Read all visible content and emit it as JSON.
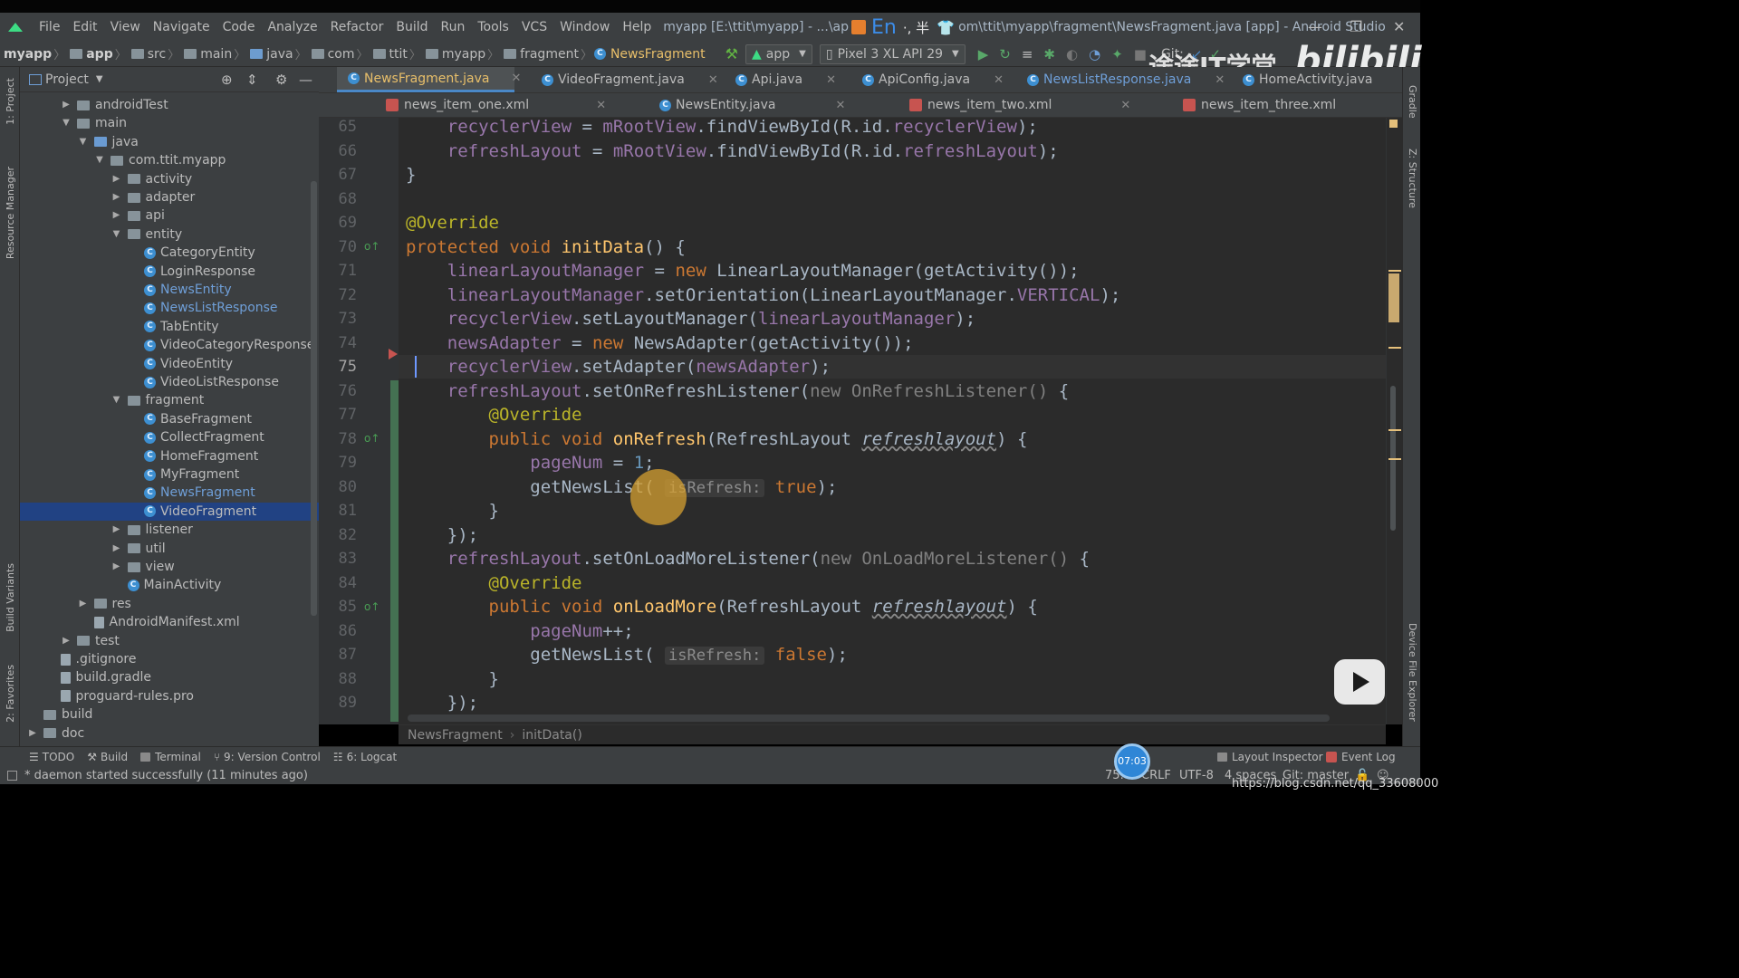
{
  "window": {
    "menu": [
      "File",
      "Edit",
      "View",
      "Navigate",
      "Code",
      "Analyze",
      "Refactor",
      "Build",
      "Run",
      "Tools",
      "VCS",
      "Window",
      "Help"
    ],
    "title_left": "myapp [E:\\ttit\\myapp] - ...\\ap",
    "ime_text": "En",
    "ime_extra": "·, 半",
    "title_right": "om\\ttit\\myapp\\fragment\\NewsFragment.java [app] - Android Studio"
  },
  "navbar": {
    "crumbs": [
      "myapp",
      "app",
      "src",
      "main",
      "java",
      "com",
      "ttit",
      "myapp",
      "fragment",
      "NewsFragment"
    ],
    "run_config": "app",
    "device": "Pixel 3 XL API 29",
    "git_label": "Git:"
  },
  "watermark": {
    "text": "途途IT学堂",
    "brand": "bilibili"
  },
  "side_left": {
    "top": "1: Project",
    "resource": "Resource Manager",
    "build_variants": "Build Variants",
    "favorites": "2: Favorites"
  },
  "side_right": {
    "gradle": "Gradle",
    "structure": "Z: Structure",
    "device_explorer": "Device File Explorer"
  },
  "project": {
    "title": "Project",
    "tree": [
      {
        "label": "androidTest",
        "depth": 3,
        "kind": "folder",
        "arrow": "▶"
      },
      {
        "label": "main",
        "depth": 3,
        "kind": "folder",
        "arrow": "▼"
      },
      {
        "label": "java",
        "depth": 4,
        "kind": "folder-blue",
        "arrow": "▼"
      },
      {
        "label": "com.ttit.myapp",
        "depth": 5,
        "kind": "pkg",
        "arrow": "▼"
      },
      {
        "label": "activity",
        "depth": 6,
        "kind": "pkg",
        "arrow": "▶"
      },
      {
        "label": "adapter",
        "depth": 6,
        "kind": "pkg",
        "arrow": "▶"
      },
      {
        "label": "api",
        "depth": 6,
        "kind": "pkg",
        "arrow": "▶"
      },
      {
        "label": "entity",
        "depth": 6,
        "kind": "pkg",
        "arrow": "▼"
      },
      {
        "label": "CategoryEntity",
        "depth": 7,
        "kind": "class",
        "arrow": ""
      },
      {
        "label": "LoginResponse",
        "depth": 7,
        "kind": "class",
        "arrow": ""
      },
      {
        "label": "NewsEntity",
        "depth": 7,
        "kind": "class-blue",
        "arrow": ""
      },
      {
        "label": "NewsListResponse",
        "depth": 7,
        "kind": "class-blue",
        "arrow": ""
      },
      {
        "label": "TabEntity",
        "depth": 7,
        "kind": "class",
        "arrow": ""
      },
      {
        "label": "VideoCategoryResponse",
        "depth": 7,
        "kind": "class",
        "arrow": ""
      },
      {
        "label": "VideoEntity",
        "depth": 7,
        "kind": "class",
        "arrow": ""
      },
      {
        "label": "VideoListResponse",
        "depth": 7,
        "kind": "class",
        "arrow": ""
      },
      {
        "label": "fragment",
        "depth": 6,
        "kind": "pkg",
        "arrow": "▼"
      },
      {
        "label": "BaseFragment",
        "depth": 7,
        "kind": "class",
        "arrow": ""
      },
      {
        "label": "CollectFragment",
        "depth": 7,
        "kind": "class",
        "arrow": ""
      },
      {
        "label": "HomeFragment",
        "depth": 7,
        "kind": "class",
        "arrow": ""
      },
      {
        "label": "MyFragment",
        "depth": 7,
        "kind": "class",
        "arrow": ""
      },
      {
        "label": "NewsFragment",
        "depth": 7,
        "kind": "class-blue",
        "arrow": ""
      },
      {
        "label": "VideoFragment",
        "depth": 7,
        "kind": "class-selected",
        "arrow": ""
      },
      {
        "label": "listener",
        "depth": 6,
        "kind": "pkg",
        "arrow": "▶"
      },
      {
        "label": "util",
        "depth": 6,
        "kind": "pkg",
        "arrow": "▶"
      },
      {
        "label": "view",
        "depth": 6,
        "kind": "pkg",
        "arrow": "▶"
      },
      {
        "label": "MainActivity",
        "depth": 6,
        "kind": "class",
        "arrow": ""
      },
      {
        "label": "res",
        "depth": 4,
        "kind": "folder",
        "arrow": "▶"
      },
      {
        "label": "AndroidManifest.xml",
        "depth": 4,
        "kind": "file",
        "arrow": ""
      },
      {
        "label": "test",
        "depth": 3,
        "kind": "folder",
        "arrow": "▶"
      },
      {
        "label": ".gitignore",
        "depth": 2,
        "kind": "file",
        "arrow": ""
      },
      {
        "label": "build.gradle",
        "depth": 2,
        "kind": "file",
        "arrow": ""
      },
      {
        "label": "proguard-rules.pro",
        "depth": 2,
        "kind": "file",
        "arrow": ""
      },
      {
        "label": "build",
        "depth": 1,
        "kind": "folder",
        "arrow": ""
      },
      {
        "label": "doc",
        "depth": 1,
        "kind": "folder",
        "arrow": "▶"
      }
    ]
  },
  "tabs_row1": [
    "NewsFragment.java",
    "VideoFragment.java",
    "Api.java",
    "ApiConfig.java",
    "NewsListResponse.java",
    "HomeActivity.java"
  ],
  "tabs_row2": [
    "news_item_one.xml",
    "NewsEntity.java",
    "news_item_two.xml",
    "news_item_three.xml"
  ],
  "editor": {
    "line_numbers": [
      "65",
      "66",
      "67",
      "68",
      "69",
      "70",
      "71",
      "72",
      "73",
      "74",
      "75",
      "76",
      "77",
      "78",
      "79",
      "80",
      "81",
      "82",
      "83",
      "84",
      "85",
      "86",
      "87",
      "88",
      "89"
    ],
    "current_line": "75",
    "hint_true": "isRefresh:",
    "hint_false": "isRefresh:",
    "breadcrumb_class": "NewsFragment",
    "breadcrumb_method": "initData()"
  },
  "tool_tabs": [
    "TODO",
    "Build",
    "Terminal",
    "9: Version Control",
    "6: Logcat"
  ],
  "tool_tabs_right": [
    "Layout Inspector",
    "Event Log"
  ],
  "status": {
    "message": "* daemon started successfully (11 minutes ago)",
    "position": "75:",
    "line_sep": "CRLF",
    "encoding": "UTF-8",
    "indent": "4 spaces",
    "git": "Git: master",
    "clock": "07:03"
  },
  "overlay": {
    "url": "https://blog.csdn.net/qq_33608000"
  }
}
